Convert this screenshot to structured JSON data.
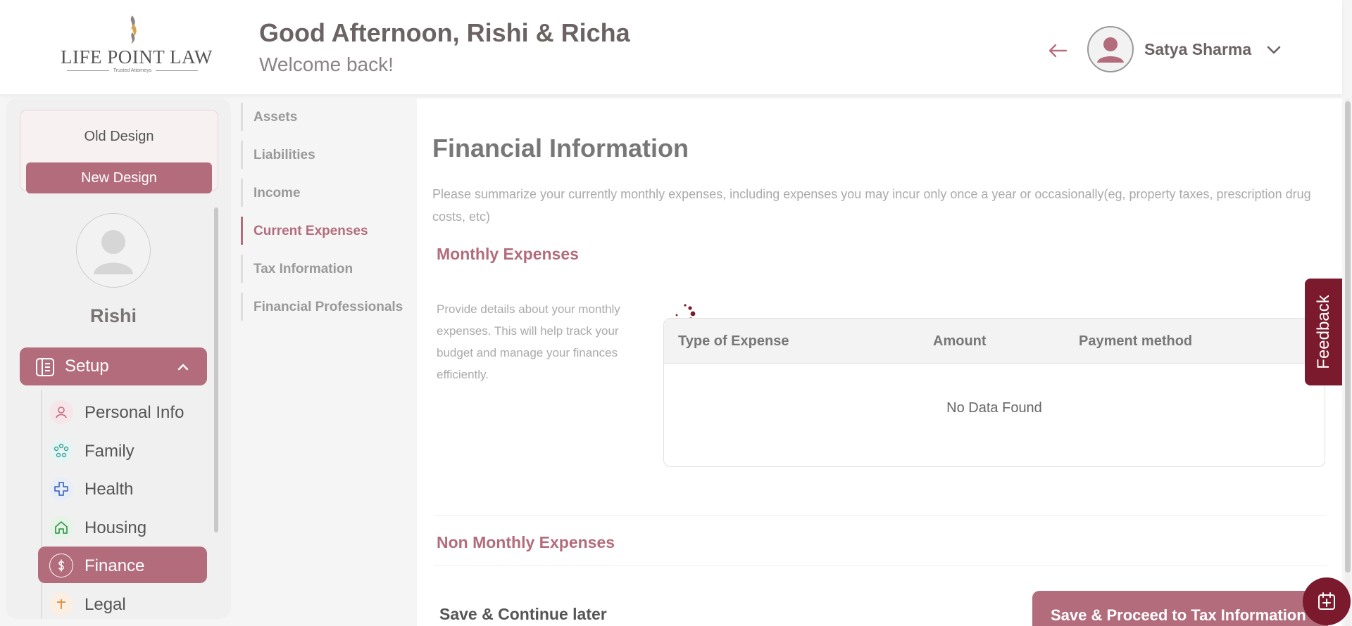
{
  "brand": {
    "name": "LIFE POINT LAW",
    "tagline": "Trusted Attorneys"
  },
  "header": {
    "greeting": "Good Afternoon, Rishi & Richa",
    "welcome": "Welcome back!",
    "user_name": "Satya Sharma"
  },
  "sidebar": {
    "old_design": "Old Design",
    "new_design": "New Design",
    "profile_name": "Rishi",
    "setup_label": "Setup",
    "items": [
      {
        "label": "Personal Info",
        "icon": "person-icon"
      },
      {
        "label": "Family",
        "icon": "family-icon"
      },
      {
        "label": "Health",
        "icon": "health-cross-icon"
      },
      {
        "label": "Housing",
        "icon": "house-icon"
      },
      {
        "label": "Finance",
        "icon": "dollar-icon"
      },
      {
        "label": "Legal",
        "icon": "legal-icon"
      }
    ]
  },
  "section_nav": [
    {
      "label": "Assets"
    },
    {
      "label": "Liabilities"
    },
    {
      "label": "Income"
    },
    {
      "label": "Current Expenses"
    },
    {
      "label": "Tax Information"
    },
    {
      "label": "Financial Professionals"
    }
  ],
  "main": {
    "title": "Financial Information",
    "intro": "Please summarize your currently monthly expenses, including expenses you may incur only once a year or occasionally(eg, property taxes, prescription drug costs, etc)",
    "monthly_title": "Monthly Expenses",
    "monthly_desc": "Provide details about your monthly expenses. This will help track your budget and manage your finances efficiently.",
    "table": {
      "columns": [
        "Type of Expense",
        "Amount",
        "Payment method"
      ],
      "empty": "No Data Found"
    },
    "non_monthly_title": "Non Monthly Expenses",
    "save_later": "Save & Continue later",
    "proceed": "Save & Proceed to Tax Information"
  },
  "feedback": "Feedback",
  "colors": {
    "accent": "#b26c7c",
    "dark_accent": "#7a1a2c"
  }
}
